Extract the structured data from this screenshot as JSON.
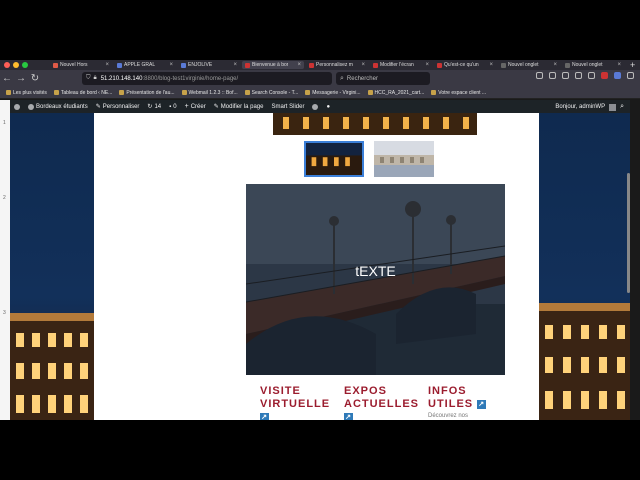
{
  "browser": {
    "tabs": [
      {
        "label": "Nouvel Hors",
        "active": false,
        "color": "#e05a47"
      },
      {
        "label": "APPLE GRAL",
        "active": false,
        "color": "#5a7ad6"
      },
      {
        "label": "ENJOLIVE",
        "active": false,
        "color": "#5a7ad6"
      },
      {
        "label": "Bienvenue à bor",
        "active": true,
        "color": "#c33"
      },
      {
        "label": "Personnalisez m",
        "active": false,
        "color": "#c33"
      },
      {
        "label": "Modifier l'écran",
        "active": false,
        "color": "#c33"
      },
      {
        "label": "Qu'est-ce qu'un",
        "active": false,
        "color": "#c33"
      },
      {
        "label": "Nouvel onglet",
        "active": false,
        "color": "#666"
      },
      {
        "label": "Nouvel onglet",
        "active": false,
        "color": "#666"
      }
    ],
    "url_host": "51.210.148.140",
    "url_path": ":8800/blog-test1virginie/home-page/",
    "search_placeholder": "Rechercher",
    "bookmarks": [
      "Les plus visités",
      "Tableau de bord ‹ NE...",
      "Présentation de l'au...",
      "Webmail 1.2.3 :: Bof...",
      "Search Console - T...",
      "Messagerie - Virgini...",
      "HCC_RA_2021_cart...",
      "Votre espace client ..."
    ]
  },
  "adminbar": {
    "site": "Bordeaux étudiants",
    "customize": "Personnaliser",
    "updates": "14",
    "comments": "0",
    "new": "Créer",
    "edit": "Modifier la page",
    "slider": "Smart Slider",
    "greeting": "Bonjour, adminWP"
  },
  "gutter_numbers": [
    "1",
    "2",
    "3"
  ],
  "hero": {
    "caption": "tEXTE"
  },
  "columns": [
    {
      "title": "VISITE VIRTUELLE",
      "desc": ""
    },
    {
      "title": "EXPOS ACTUELLES",
      "desc": ""
    },
    {
      "title": "INFOS UTILES",
      "desc": "Découvrez nos"
    }
  ],
  "colors": {
    "accent": "#9b1c2e",
    "link_icon": "#2f7ab8",
    "admin_bar": "#1d2327"
  }
}
